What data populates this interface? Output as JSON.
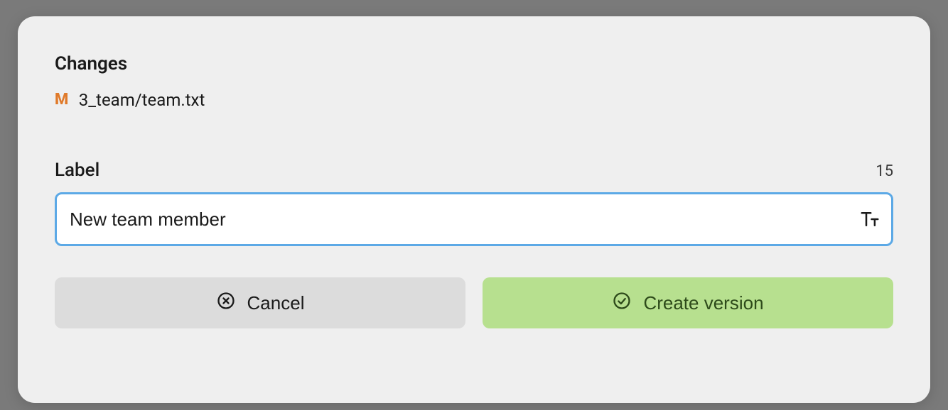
{
  "modal": {
    "changes_heading": "Changes",
    "changes": [
      {
        "status": "M",
        "path": "3_team/team.txt"
      }
    ],
    "label_heading": "Label",
    "char_count": "15",
    "input_value": "New team member",
    "cancel_label": "Cancel",
    "create_label": "Create version"
  },
  "colors": {
    "status_modified": "#e07a2a",
    "input_border_focus": "#5ca9e6",
    "btn_cancel_bg": "#dcdcdc",
    "btn_create_bg": "#b7e08f"
  }
}
